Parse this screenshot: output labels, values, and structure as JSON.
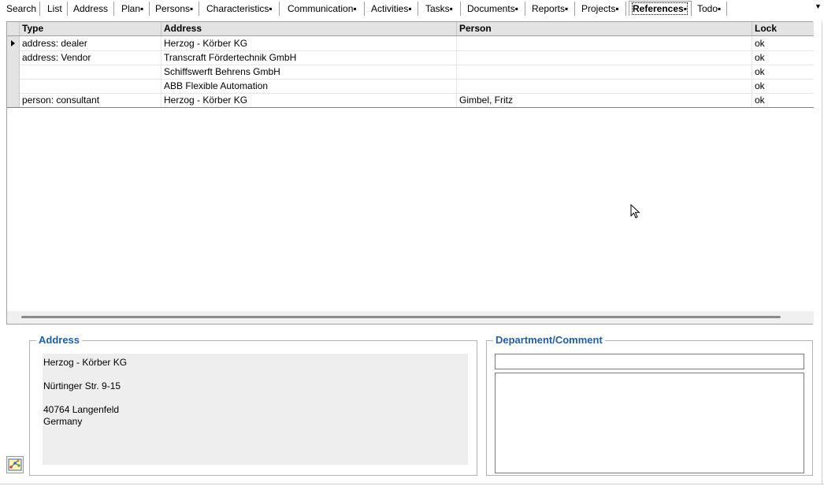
{
  "tabs": [
    {
      "label": "Search"
    },
    {
      "label": "List"
    },
    {
      "label": "Address"
    },
    {
      "label": "Plan▪"
    },
    {
      "label": "Persons▪"
    },
    {
      "label": "Characteristics▪"
    },
    {
      "label": "Communication▪"
    },
    {
      "label": "Activities▪"
    },
    {
      "label": "Tasks▪"
    },
    {
      "label": "Documents▪"
    },
    {
      "label": "Reports▪"
    },
    {
      "label": "Projects▪"
    },
    {
      "label": "References▪"
    },
    {
      "label": "Todo▪"
    }
  ],
  "active_tab": "References▪",
  "grid": {
    "columns": [
      "Type",
      "Address",
      "Person",
      "Lock"
    ],
    "rows": [
      {
        "type": "address: dealer",
        "address": "Herzog - Körber KG",
        "person": "",
        "lock": "ok",
        "current": true
      },
      {
        "type": "address: Vendor",
        "address": "Transcraft Fördertechnik GmbH",
        "person": "",
        "lock": "ok",
        "current": false
      },
      {
        "type": "",
        "address": "Schiffswerft Behrens GmbH",
        "person": "",
        "lock": "ok",
        "current": false
      },
      {
        "type": "",
        "address": "ABB Flexible Automation",
        "person": "",
        "lock": "ok",
        "current": false
      },
      {
        "type": "person: consultant",
        "address": "Herzog - Körber KG",
        "person": "Gimbel, Fritz",
        "lock": "ok",
        "current": false
      }
    ]
  },
  "address_panel": {
    "title": "Address",
    "lines": [
      "Herzog - Körber KG",
      "",
      "Nürtinger Str. 9-15",
      "",
      "40764 Langenfeld",
      "Germany"
    ]
  },
  "department_panel": {
    "title": "Department/Comment",
    "department_value": "",
    "comment_value": ""
  },
  "colors": {
    "group_title": "#1f5fa8",
    "header_bg": "#e3e3e3",
    "address_bg": "#eeeeee"
  }
}
